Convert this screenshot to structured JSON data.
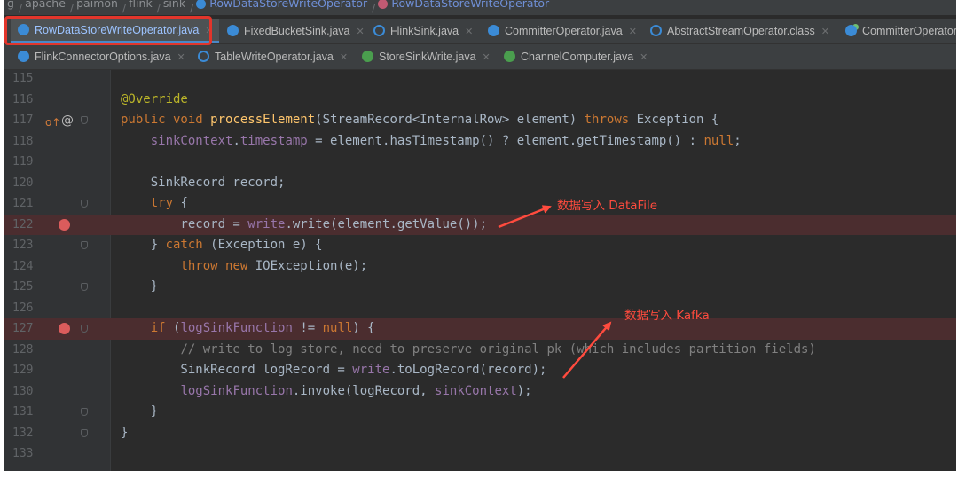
{
  "breadcrumb": [
    "g",
    "apache",
    "paimon",
    "flink",
    "sink",
    "RowDataStoreWriteOperator",
    "RowDataStoreWriteOperator"
  ],
  "tabs_row1": [
    {
      "label": "RowDataStoreWriteOperator.java",
      "icon": "class-icon",
      "active": true
    },
    {
      "label": "FixedBucketSink.java",
      "icon": "class-icon"
    },
    {
      "label": "FlinkSink.java",
      "icon": "abstract-class-icon"
    },
    {
      "label": "CommitterOperator.java",
      "icon": "class-icon"
    },
    {
      "label": "AbstractStreamOperator.class",
      "icon": "abstract-class-icon"
    },
    {
      "label": "CommitterOperator",
      "icon": "class-final-icon"
    }
  ],
  "tabs_row2": [
    {
      "label": "FlinkConnectorOptions.java",
      "icon": "class-icon"
    },
    {
      "label": "TableWriteOperator.java",
      "icon": "abstract-class-icon"
    },
    {
      "label": "StoreSinkWrite.java",
      "icon": "interface-icon"
    },
    {
      "label": "ChannelComputer.java",
      "icon": "interface-icon"
    }
  ],
  "code_lines": [
    {
      "n": "115",
      "html": ""
    },
    {
      "n": "116",
      "html": "<span class=\"an\">@Override</span>"
    },
    {
      "n": "117",
      "html": "<span class=\"kw\">public void </span><span class=\"fn\">processElement</span>(StreamRecord&lt;InternalRow&gt; element) <span class=\"kw\">throws </span>Exception {"
    },
    {
      "n": "118",
      "html": "    <span class=\"fld\">sinkContext</span>.<span class=\"fld\">timestamp</span> = element.hasTimestamp() ? element.getTimestamp() : <span class=\"kw\">null</span>;"
    },
    {
      "n": "119",
      "html": ""
    },
    {
      "n": "120",
      "html": "    SinkRecord record;"
    },
    {
      "n": "121",
      "html": "    <span class=\"kw\">try </span>{"
    },
    {
      "n": "122",
      "html": "        record = <span class=\"fld\">write</span>.write(element.getValue());"
    },
    {
      "n": "123",
      "html": "    } <span class=\"kw\">catch </span>(Exception e) {"
    },
    {
      "n": "124",
      "html": "        <span class=\"kw\">throw new </span>IOException(e);"
    },
    {
      "n": "125",
      "html": "    }"
    },
    {
      "n": "126",
      "html": ""
    },
    {
      "n": "127",
      "html": "    <span class=\"kw\">if </span>(<span class=\"fld\">logSinkFunction </span>!= <span class=\"kw\">null</span>) {"
    },
    {
      "n": "128",
      "html": "        <span class=\"cm\">// write to log store, need to preserve original pk (which includes partition fields)</span>"
    },
    {
      "n": "129",
      "html": "        SinkRecord logRecord = <span class=\"fld\">write</span>.toLogRecord(record);"
    },
    {
      "n": "130",
      "html": "        <span class=\"fld\">logSinkFunction</span>.invoke(logRecord, <span class=\"fld\">sinkContext</span>);"
    },
    {
      "n": "131",
      "html": "    }"
    },
    {
      "n": "132",
      "html": "}"
    },
    {
      "n": "133",
      "html": ""
    }
  ],
  "annotations": {
    "datafile": "数据写入 DataFile",
    "kafka": "数据写入 Kafka"
  },
  "colors": {
    "annotation_red": "#ff4b3e",
    "highlight_box": "#e2352b",
    "editor_bg": "#2b2b2b",
    "breakpoint_bg": "#4b2d2f"
  }
}
